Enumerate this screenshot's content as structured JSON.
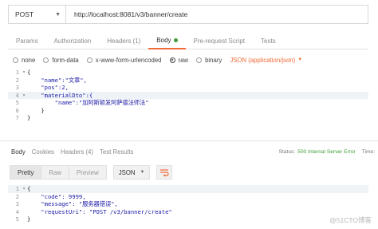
{
  "request": {
    "method": "POST",
    "url": "http://localhost:8081/v3/banner/create"
  },
  "request_tabs": [
    {
      "label": "Params",
      "active": false
    },
    {
      "label": "Authorization",
      "active": false
    },
    {
      "label": "Headers",
      "count": "(1)",
      "active": false
    },
    {
      "label": "Body",
      "active": true
    },
    {
      "label": "Pre-request Script",
      "active": false
    },
    {
      "label": "Tests",
      "active": false
    }
  ],
  "body_types": {
    "none": "none",
    "form_data": "form-data",
    "urlencoded": "x-www-form-urlencoded",
    "raw": "raw",
    "binary": "binary",
    "selected": "raw",
    "format": "JSON (application/json)"
  },
  "request_body": {
    "line_numbers": [
      "1",
      "2",
      "3",
      "4",
      "5",
      "6",
      "7"
    ],
    "lines": [
      "{",
      "    \"name\":\"文章\",",
      "    \"pos\":2,",
      "    \"materialDto\":{",
      "        \"name\":\"加阿斯顿发阿萨德法师法\"",
      "    }",
      "}"
    ]
  },
  "response_tabs": {
    "body": "Body",
    "cookies": "Cookies",
    "headers": "Headers",
    "headers_count": "(4)",
    "test_results": "Test Results"
  },
  "status": {
    "label": "Status:",
    "value": "500 Internal Server Error",
    "time_label": "Time:"
  },
  "response_toolbar": {
    "pretty": "Pretty",
    "raw": "Raw",
    "preview": "Preview",
    "format": "JSON"
  },
  "response_body": {
    "line_numbers": [
      "1",
      "2",
      "3",
      "4",
      "5"
    ],
    "lines": [
      "{",
      "    \"code\": 9999,",
      "    \"message\": \"服务器错误\",",
      "    \"requestUri\": \"POST /v3/banner/create\"",
      "}"
    ]
  },
  "watermark": "@51CTO博客",
  "colors": {
    "accent": "#f26b3a",
    "success": "#3f9c35"
  }
}
